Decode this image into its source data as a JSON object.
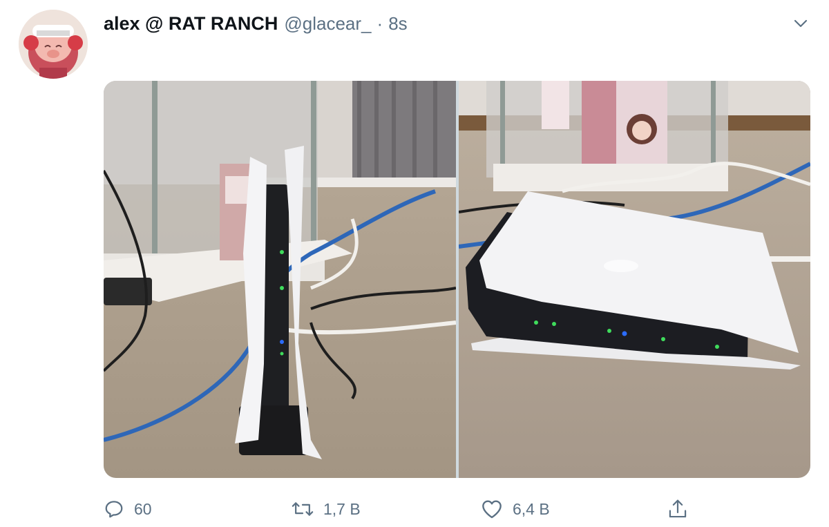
{
  "tweet": {
    "display_name": "alex @ RAT RANCH",
    "handle": "@glacear_",
    "separator": "·",
    "time": "8s"
  },
  "icons": {
    "menu": "chevron-down-icon",
    "reply": "reply-icon",
    "retweet": "retweet-icon",
    "like": "heart-icon",
    "share": "share-icon"
  },
  "actions": {
    "replies": "60",
    "retweets": "1,7 B",
    "likes": "6,4 B"
  },
  "colors": {
    "text_primary": "#0f1419",
    "text_secondary": "#5b7083",
    "divider": "#ffffff"
  }
}
